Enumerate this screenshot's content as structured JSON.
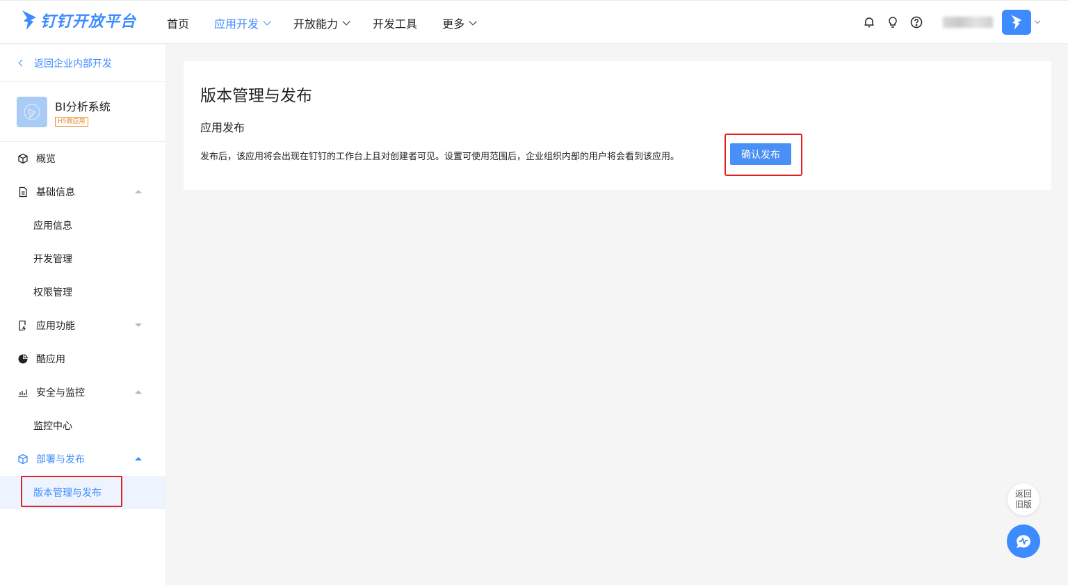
{
  "header": {
    "logo_text": "钉钉开放平台",
    "nav": [
      {
        "label": "首页"
      },
      {
        "label": "应用开发"
      },
      {
        "label": "开放能力"
      },
      {
        "label": "开发工具"
      },
      {
        "label": "更多"
      }
    ],
    "icons": [
      "bell-icon",
      "lightbulb-icon",
      "help-icon"
    ]
  },
  "sidebar": {
    "back_label": "返回企业内部开发",
    "app": {
      "name": "BI分析系统",
      "tag": "H5微应用"
    },
    "items": [
      {
        "label": "概览"
      },
      {
        "label": "基础信息"
      },
      {
        "label": "应用信息"
      },
      {
        "label": "开发管理"
      },
      {
        "label": "权限管理"
      },
      {
        "label": "应用功能"
      },
      {
        "label": "酷应用"
      },
      {
        "label": "安全与监控"
      },
      {
        "label": "监控中心"
      },
      {
        "label": "部署与发布"
      },
      {
        "label": "版本管理与发布"
      }
    ]
  },
  "main": {
    "title": "版本管理与发布",
    "section_title": "应用发布",
    "description": "发布后，该应用将会出现在钉钉的工作台上且对创建者可见。设置可使用范围后，企业组织内部的用户将会看到该应用。",
    "confirm_label": "确认发布"
  },
  "floating": {
    "old_version_line1": "返回",
    "old_version_line2": "旧版"
  },
  "colors": {
    "accent": "#3d8bff",
    "highlight": "#e02020"
  }
}
